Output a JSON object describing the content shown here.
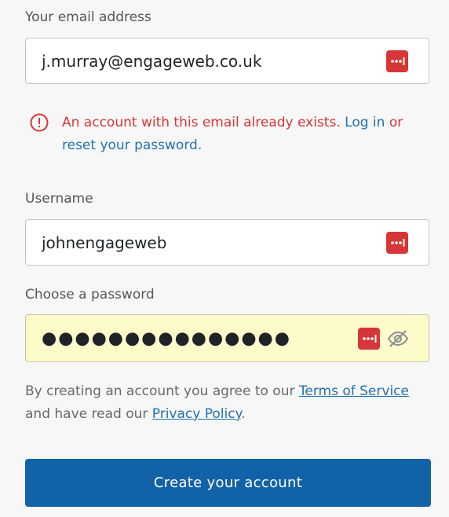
{
  "email": {
    "label": "Your email address",
    "value": "j.murray@engageweb.co.uk"
  },
  "error": {
    "message": "An account with this email already exists.",
    "login_link": "Log in",
    "or_text": "or",
    "reset_link": "reset your password",
    "period": "."
  },
  "username": {
    "label": "Username",
    "value": "johnengageweb"
  },
  "password": {
    "label": "Choose a password",
    "value": "●●●●●●●●●●●●●●●"
  },
  "terms": {
    "prefix": "By creating an account you agree to our",
    "tos_link": "Terms of Service",
    "middle": "and have read our",
    "privacy_link": "Privacy Policy",
    "suffix": "."
  },
  "submit": {
    "label": "Create your account"
  },
  "colors": {
    "error": "#d63638",
    "link": "#2271b1",
    "button": "#1262a8",
    "autofill": "#fdfbc9"
  },
  "icons": {
    "password_manager": "password-manager-icon",
    "error": "error-circle-icon",
    "visibility": "eye-slash-icon"
  }
}
